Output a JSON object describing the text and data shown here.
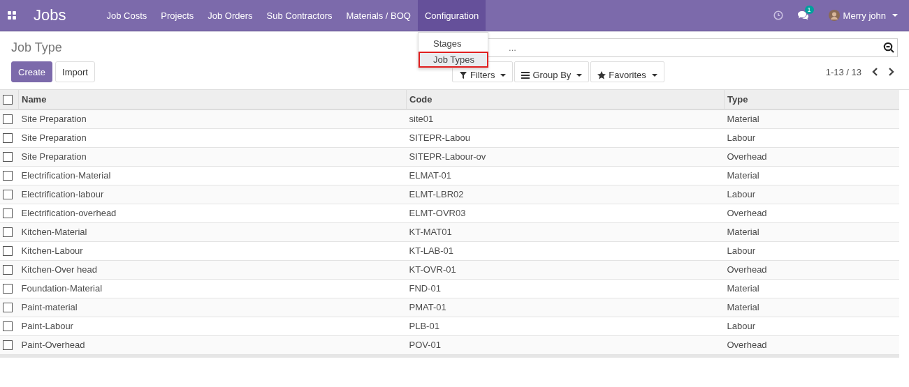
{
  "navbar": {
    "app_title": "Jobs",
    "menu": [
      {
        "label": "Job Costs",
        "selected": false
      },
      {
        "label": "Projects",
        "selected": false
      },
      {
        "label": "Job Orders",
        "selected": false
      },
      {
        "label": "Sub Contractors",
        "selected": false
      },
      {
        "label": "Materials / BOQ",
        "selected": false
      },
      {
        "label": "Configuration",
        "selected": true
      }
    ],
    "message_count": "1",
    "user": "Merry john"
  },
  "dropdown": {
    "items": [
      {
        "label": "Stages",
        "selected": false
      },
      {
        "label": "Job Types",
        "selected": true
      }
    ]
  },
  "breadcrumb": "Job Type",
  "buttons": [
    "Create",
    "Import"
  ],
  "search": {
    "placeholder": "..."
  },
  "filters": [
    "Filters",
    "Group By",
    "Favorites"
  ],
  "pager": "1-13 / 13",
  "table": {
    "select_all": false,
    "columns": [
      "Name",
      "Code",
      "Type"
    ],
    "rows": [
      {
        "name": "Site Preparation",
        "code": "site01",
        "type": "Material",
        "checked": false
      },
      {
        "name": "Site Preparation",
        "code": "SITEPR-Labou",
        "type": "Labour",
        "checked": false
      },
      {
        "name": "Site Preparation",
        "code": "SITEPR-Labour-ov",
        "type": "Overhead",
        "checked": false
      },
      {
        "name": "Electrification-Material",
        "code": "ELMAT-01",
        "type": "Material",
        "checked": false
      },
      {
        "name": "Electrification-labour",
        "code": "ELMT-LBR02",
        "type": "Labour",
        "checked": false
      },
      {
        "name": "Electrification-overhead",
        "code": "ELMT-OVR03",
        "type": "Overhead",
        "checked": false
      },
      {
        "name": "Kitchen-Material",
        "code": "KT-MAT01",
        "type": "Material",
        "checked": false
      },
      {
        "name": "Kitchen-Labour",
        "code": "KT-LAB-01",
        "type": "Labour",
        "checked": false
      },
      {
        "name": "Kitchen-Over head",
        "code": "KT-OVR-01",
        "type": "Overhead",
        "checked": false
      },
      {
        "name": "Foundation-Material",
        "code": "FND-01",
        "type": "Material",
        "checked": false
      },
      {
        "name": "Paint-material",
        "code": "PMAT-01",
        "type": "Material",
        "checked": false
      },
      {
        "name": "Paint-Labour",
        "code": "PLB-01",
        "type": "Labour",
        "checked": false
      },
      {
        "name": "Paint-Overhead",
        "code": "POV-01",
        "type": "Overhead",
        "checked": false
      }
    ]
  }
}
